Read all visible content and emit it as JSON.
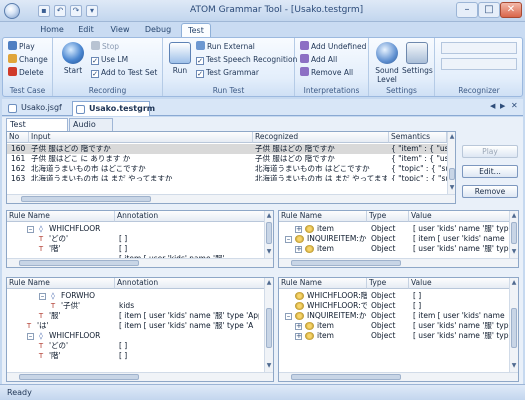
{
  "window": {
    "title": "ATOM Grammar Tool - [Usako.testgrm]"
  },
  "quick_access": [
    "save-icon",
    "undo-icon",
    "redo-icon",
    "customize-icon"
  ],
  "ribbon_tabs": [
    "Home",
    "Edit",
    "View",
    "Debug",
    "Test"
  ],
  "ribbon_active_tab": "Test",
  "ribbon": {
    "test_case": {
      "label": "Test Case",
      "play": "Play",
      "change": "Change",
      "delete": "Delete"
    },
    "recording": {
      "label": "Recording",
      "start": "Start",
      "stop": "Stop",
      "use_lm": "Use LM",
      "add_to_test_set": "Add to Test Set"
    },
    "run_test": {
      "label": "Run Test",
      "run": "Run",
      "run_external": "Run External",
      "test_speech_recognition": "Test Speech Recognition",
      "test_grammar": "Test Grammar"
    },
    "interpretations": {
      "label": "Interpretations",
      "add_undefined": "Add Undefined",
      "add_all": "Add All",
      "remove_all": "Remove All"
    },
    "settings": {
      "label": "Settings",
      "sound_level": "Sound\nLevel",
      "settings": "Settings"
    },
    "recognizer": {
      "label": "Recognizer"
    }
  },
  "doc_tabs": [
    "Usako.jsgf",
    "Usako.testgrm"
  ],
  "active_doc_tab": "Usako.testgrm",
  "sentence_tabs": [
    "Test Sentences",
    "Audio Input"
  ],
  "sentences": {
    "columns": [
      "No",
      "Input",
      "Recognized",
      "Semantics"
    ],
    "rows": [
      {
        "no": "160",
        "input": "子供 服はどの 階ですか",
        "recognized": "子供 服はどの 階ですか",
        "semantics": "{ \"item\" : { \"user"
      },
      {
        "no": "161",
        "input": "子供 服はどこ に あります か",
        "recognized": "子供 服はどの 階ですか",
        "semantics": "{ \"item\" : { \"user\""
      },
      {
        "no": "162",
        "input": "北海道うまいもの市 はどこですか",
        "recognized": "北海道うまいもの市 はどこですか",
        "semantics": "{ \"topic\" : { \"subt"
      },
      {
        "no": "163",
        "input": "北海道うまいもの市 は まだ やってますか",
        "recognized": "北海道うまいもの市 は まだ やってますか",
        "semantics": "{ \"topic\" : { \"subt"
      }
    ],
    "selected_row": 0
  },
  "buttons": {
    "play": "Play",
    "edit": "Edit...",
    "remove": "Remove"
  },
  "top_left": {
    "columns": [
      "Rule Name",
      "Annotation"
    ],
    "rows": [
      {
        "name": "WHICHFLOOR",
        "annotation": "",
        "kind": "rule"
      },
      {
        "name": "'どの'",
        "annotation": "[ ]",
        "kind": "token"
      },
      {
        "name": "'階'",
        "annotation": "[ ]",
        "kind": "token"
      },
      {
        "name": "...",
        "annotation": "[ item [ user 'kids'  name '服'",
        "kind": "token"
      }
    ]
  },
  "top_right": {
    "columns": [
      "Rule Name",
      "Type",
      "Value"
    ],
    "rows": [
      {
        "name": "item",
        "type": "Object",
        "value": "[ user 'kids'  name '服'  type 'A"
      },
      {
        "name": "INQUIREITEM:か",
        "type": "Object",
        "value": "[ item [ user 'kids'      name"
      },
      {
        "name": "item",
        "type": "Object",
        "value": "[ user 'kids'  name '服'  type 'A"
      }
    ]
  },
  "bottom_left": {
    "columns": [
      "Rule Name",
      "Annotation"
    ],
    "rows": [
      {
        "name": "FORWHO",
        "annotation": "",
        "kind": "rule"
      },
      {
        "name": "'子供'",
        "annotation": "kids",
        "kind": "token"
      },
      {
        "name": "'服'",
        "annotation": "[ item [ user 'kids'   name '服'    type 'Apparel'item']",
        "kind": "token"
      },
      {
        "name": "'は'",
        "annotation": "[ item [ user 'kids'      name '服'        type 'A",
        "kind": "token"
      },
      {
        "name": "WHICHFLOOR",
        "annotation": "",
        "kind": "rule"
      },
      {
        "name": "'どの'",
        "annotation": "[ ]",
        "kind": "token"
      },
      {
        "name": "'階'",
        "annotation": "[ ]",
        "kind": "token"
      }
    ]
  },
  "bottom_right": {
    "columns": [
      "Rule Name",
      "Type",
      "Value"
    ],
    "rows": [
      {
        "name": "WHICHFLOOR:階",
        "type": "Object",
        "value": "[ ]"
      },
      {
        "name": "WHICHFLOOR:で",
        "type": "Object",
        "value": "[ ]"
      },
      {
        "name": "INQUIREITEM:か",
        "type": "Object",
        "value": "[ item [ user 'kids'      name"
      },
      {
        "name": "item",
        "type": "Object",
        "value": "[ user 'kids'  name '服'  type 'A"
      },
      {
        "name": "item",
        "type": "Object",
        "value": "[ user 'kids'  name '服'  type 'A"
      },
      {
        "name": "...",
        "type": "...",
        "value": "..."
      }
    ]
  },
  "status": {
    "text": "Ready"
  },
  "colors": {
    "accent": "#2b5797",
    "selected_row": "#d9d9d9"
  }
}
